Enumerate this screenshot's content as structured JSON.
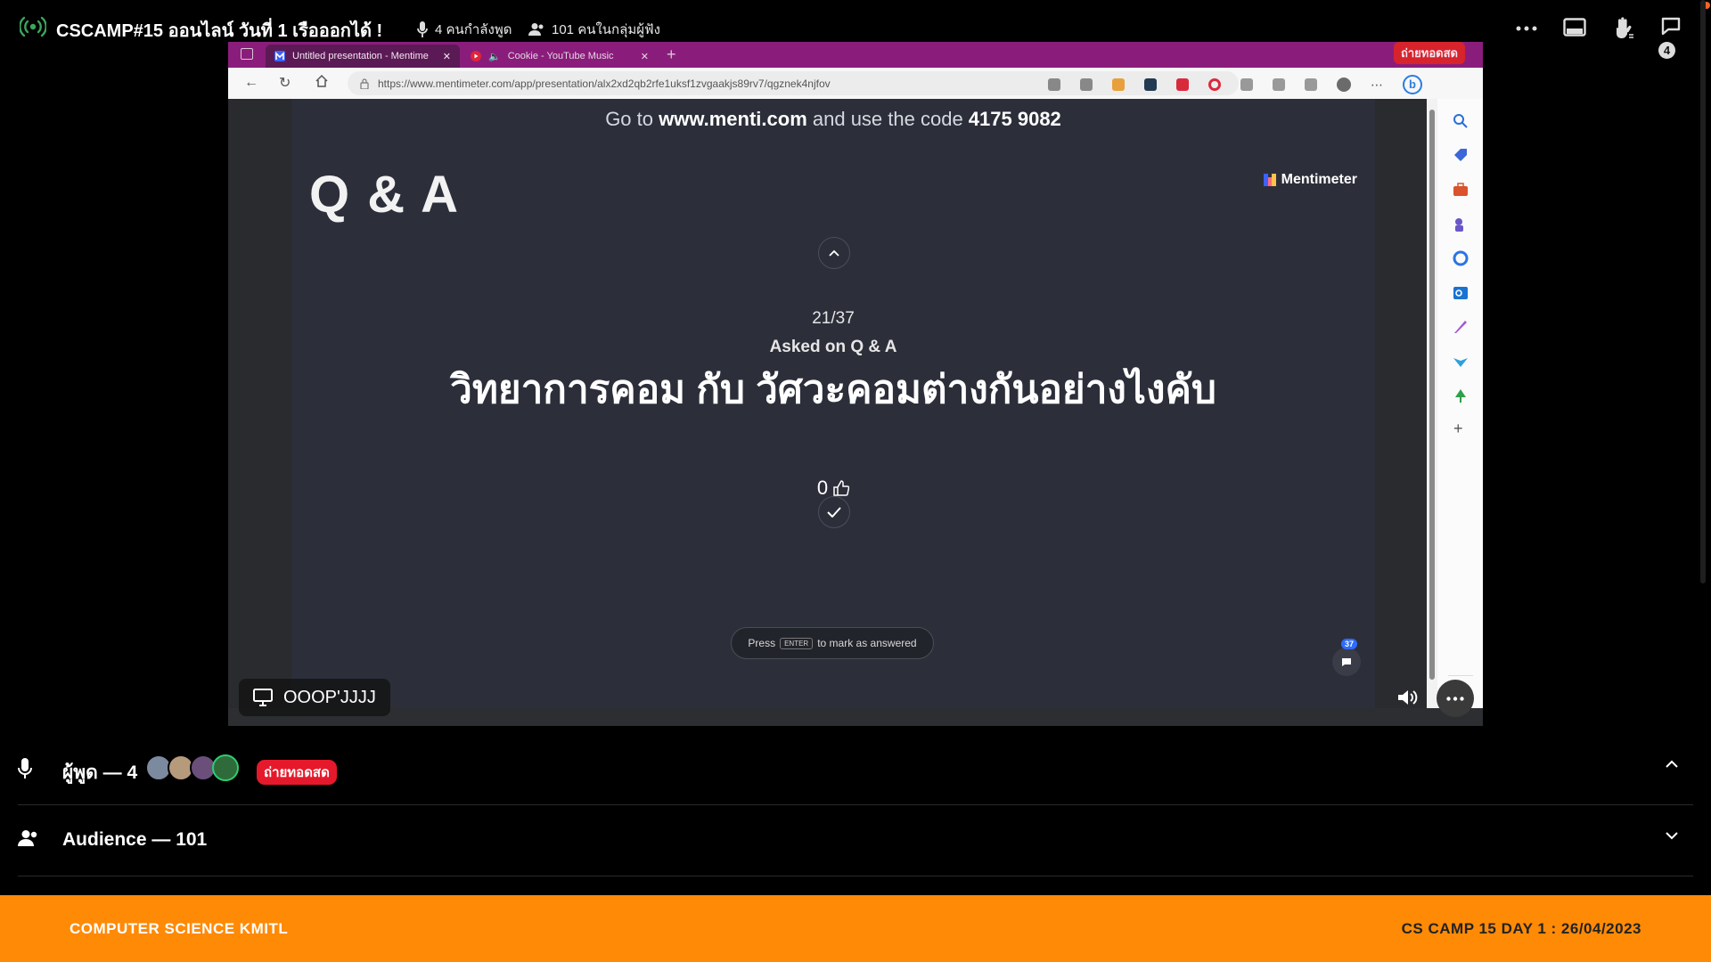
{
  "stage": {
    "title": "CSCAMP#15 ออนไลน์ วันที่ 1 เรือออกได้ !",
    "speaking": "4 คนกำลังพูด",
    "listening": "101 คนในกลุ่มผู้ฟัง",
    "inbox_count": "4"
  },
  "browser": {
    "tabs": [
      {
        "label": "Untitled presentation - Mentime"
      },
      {
        "label": "Cookie - YouTube Music"
      }
    ],
    "live_overlay": "ถ่ายทอดสด",
    "url": "https://www.mentimeter.com/app/presentation/alx2xd2qb2rfe1uksf1zvgaakjs89rv7/qgznek4njfov"
  },
  "presentation": {
    "join_prefix": "Go to ",
    "join_site": "www.menti.com",
    "join_middle": " and use the code ",
    "join_code": "4175 9082",
    "qa_title": "Q & A",
    "brand": "Mentimeter",
    "counter": "21/37",
    "asked_on": "Asked on Q & A",
    "question": "วิทยาการคอม กับ วัศวะคอมต่างกันอย่างไงคับ",
    "likes": "0",
    "hint_press": "Press",
    "hint_key": "ENTER",
    "hint_rest": "to mark as answered",
    "question_badge": "37"
  },
  "share": {
    "sharer_name": "OOOP'JJJJ"
  },
  "speakers": {
    "label": "ผู้พูด — 4",
    "live_badge": "ถ่ายทอดสด",
    "avatar_colors": [
      "#7c8aa0",
      "#b69a7c",
      "#6a4f7a",
      "#2f6b3a"
    ]
  },
  "audience": {
    "label": "Audience — 101"
  },
  "footer": {
    "left": "COMPUTER SCIENCE KMITL",
    "right": "CS CAMP 15 DAY 1 : 26/04/2023"
  }
}
